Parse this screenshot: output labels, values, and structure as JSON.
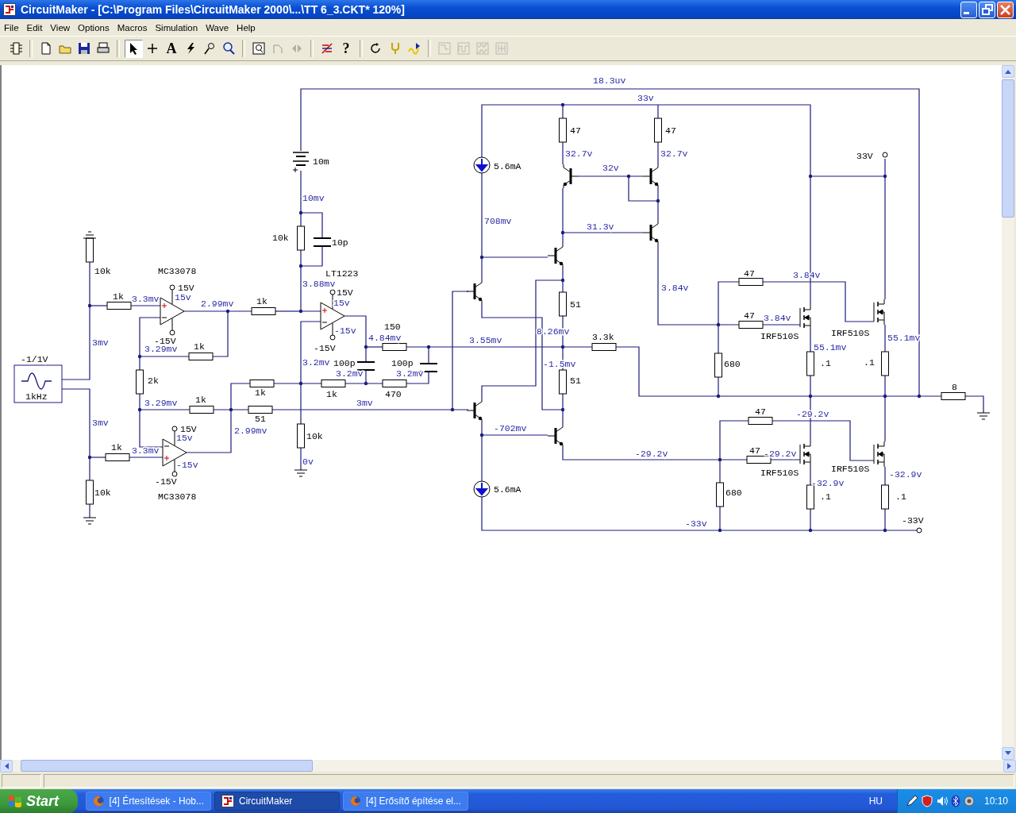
{
  "window": {
    "title": "CircuitMaker - [C:\\Program Files\\CircuitMaker 2000\\...\\TT 6_3.CKT* 120%]"
  },
  "menu": [
    "File",
    "Edit",
    "View",
    "Options",
    "Macros",
    "Simulation",
    "Wave",
    "Help"
  ],
  "toolbar": [
    {
      "selected": false,
      "disabled": false
    },
    {
      "selected": false,
      "disabled": false
    },
    {
      "selected": false,
      "disabled": false
    },
    {
      "selected": false,
      "disabled": false
    },
    {
      "selected": false,
      "disabled": false
    },
    {
      "selected": true,
      "disabled": false
    },
    {
      "selected": false,
      "disabled": false
    },
    {
      "selected": false,
      "disabled": false,
      "label": "A"
    },
    {
      "selected": false,
      "disabled": false
    },
    {
      "selected": false,
      "disabled": false
    },
    {
      "selected": false,
      "disabled": false
    },
    {
      "selected": false,
      "disabled": false
    },
    {
      "selected": false,
      "disabled": true
    },
    {
      "selected": false,
      "disabled": true
    },
    {
      "selected": false,
      "disabled": false
    },
    {
      "selected": false,
      "disabled": false,
      "label": "?"
    },
    {
      "selected": false,
      "disabled": false
    },
    {
      "selected": false,
      "disabled": false
    },
    {
      "selected": false,
      "disabled": false
    },
    {
      "selected": false,
      "disabled": true
    },
    {
      "selected": false,
      "disabled": true
    },
    {
      "selected": false,
      "disabled": true
    },
    {
      "selected": false,
      "disabled": true
    }
  ],
  "schematic": {
    "labels": [
      {
        "text": "18.3uv",
        "kind": "voltage"
      },
      {
        "text": "33v",
        "kind": "voltage"
      },
      {
        "text": "47",
        "kind": "part"
      },
      {
        "text": "47",
        "kind": "part"
      },
      {
        "text": "32.7v",
        "kind": "voltage"
      },
      {
        "text": "32.7v",
        "kind": "voltage"
      },
      {
        "text": "33V",
        "kind": "part"
      },
      {
        "text": "10m",
        "kind": "part"
      },
      {
        "text": "5.6mA",
        "kind": "part"
      },
      {
        "text": "32v",
        "kind": "voltage"
      },
      {
        "text": "10mv",
        "kind": "voltage"
      },
      {
        "text": "708mv",
        "kind": "voltage"
      },
      {
        "text": "31.3v",
        "kind": "voltage"
      },
      {
        "text": "10k",
        "kind": "part"
      },
      {
        "text": "10p",
        "kind": "part"
      },
      {
        "text": "10k",
        "kind": "part"
      },
      {
        "text": "MC33078",
        "kind": "part"
      },
      {
        "text": "LT1223",
        "kind": "part"
      },
      {
        "text": "47",
        "kind": "part"
      },
      {
        "text": "3.84v",
        "kind": "voltage"
      },
      {
        "text": "15V",
        "kind": "part"
      },
      {
        "text": "3.88mv",
        "kind": "voltage"
      },
      {
        "text": "3.84v",
        "kind": "voltage"
      },
      {
        "text": "15V",
        "kind": "part"
      },
      {
        "text": "1k",
        "kind": "part"
      },
      {
        "text": "3.3mv",
        "kind": "voltage"
      },
      {
        "text": "15v",
        "kind": "voltage"
      },
      {
        "text": "2.99mv",
        "kind": "voltage"
      },
      {
        "text": "1k",
        "kind": "part"
      },
      {
        "text": "15v",
        "kind": "voltage"
      },
      {
        "text": "51",
        "kind": "part"
      },
      {
        "text": "47",
        "kind": "part"
      },
      {
        "text": "3.84v",
        "kind": "voltage"
      },
      {
        "text": "-15v",
        "kind": "voltage"
      },
      {
        "text": "150",
        "kind": "part"
      },
      {
        "text": "8.26mv",
        "kind": "voltage"
      },
      {
        "text": "IRF510S",
        "kind": "part"
      },
      {
        "text": "3mv",
        "kind": "voltage"
      },
      {
        "text": "-15V",
        "kind": "part"
      },
      {
        "text": "4.84mv",
        "kind": "voltage"
      },
      {
        "text": "3.55mv",
        "kind": "voltage"
      },
      {
        "text": "3.3k",
        "kind": "part"
      },
      {
        "text": "IRF510S",
        "kind": "part"
      },
      {
        "text": "55.1mv",
        "kind": "voltage"
      },
      {
        "text": "3.29mv",
        "kind": "voltage"
      },
      {
        "text": "1k",
        "kind": "part"
      },
      {
        "text": "-15V",
        "kind": "part"
      },
      {
        "text": "55.1mv",
        "kind": "voltage"
      },
      {
        "text": "-1/1V",
        "kind": "part"
      },
      {
        "text": "3.2mv",
        "kind": "voltage"
      },
      {
        "text": "100p",
        "kind": "part"
      },
      {
        "text": "100p",
        "kind": "part"
      },
      {
        "text": "-1.5mv",
        "kind": "voltage"
      },
      {
        "text": "680",
        "kind": "part"
      },
      {
        "text": ".1",
        "kind": "part"
      },
      {
        "text": ".1",
        "kind": "part"
      },
      {
        "text": "3.2mv",
        "kind": "voltage"
      },
      {
        "text": "3.2mv",
        "kind": "voltage"
      },
      {
        "text": "2k",
        "kind": "part"
      },
      {
        "text": "51",
        "kind": "part"
      },
      {
        "text": "8",
        "kind": "part"
      },
      {
        "text": "1kHz",
        "kind": "part"
      },
      {
        "text": "1k",
        "kind": "part"
      },
      {
        "text": "1k",
        "kind": "part"
      },
      {
        "text": "470",
        "kind": "part"
      },
      {
        "text": "3.29mv",
        "kind": "voltage"
      },
      {
        "text": "1k",
        "kind": "part"
      },
      {
        "text": "3mv",
        "kind": "voltage"
      },
      {
        "text": "47",
        "kind": "part"
      },
      {
        "text": "-29.2v",
        "kind": "voltage"
      },
      {
        "text": "3mv",
        "kind": "voltage"
      },
      {
        "text": "51",
        "kind": "part"
      },
      {
        "text": "15V",
        "kind": "part"
      },
      {
        "text": "2.99mv",
        "kind": "voltage"
      },
      {
        "text": "-702mv",
        "kind": "voltage"
      },
      {
        "text": "15v",
        "kind": "voltage"
      },
      {
        "text": "10k",
        "kind": "part"
      },
      {
        "text": "1k",
        "kind": "part"
      },
      {
        "text": "3.3mv",
        "kind": "voltage"
      },
      {
        "text": "-29.2v",
        "kind": "voltage"
      },
      {
        "text": "47",
        "kind": "part"
      },
      {
        "text": "-29.2v",
        "kind": "voltage"
      },
      {
        "text": "-15v",
        "kind": "voltage"
      },
      {
        "text": "0v",
        "kind": "voltage"
      },
      {
        "text": "IRF510S",
        "kind": "part"
      },
      {
        "text": "IRF510S",
        "kind": "part"
      },
      {
        "text": "-32.9v",
        "kind": "voltage"
      },
      {
        "text": "-15V",
        "kind": "part"
      },
      {
        "text": "-32.9v",
        "kind": "voltage"
      },
      {
        "text": "10k",
        "kind": "part"
      },
      {
        "text": "MC33078",
        "kind": "part"
      },
      {
        "text": "5.6mA",
        "kind": "part"
      },
      {
        "text": "680",
        "kind": "part"
      },
      {
        "text": ".1",
        "kind": "part"
      },
      {
        "text": ".1",
        "kind": "part"
      },
      {
        "text": "-33v",
        "kind": "voltage"
      },
      {
        "text": "-33V",
        "kind": "part"
      }
    ]
  },
  "taskbar": {
    "start": "Start",
    "tasks": [
      {
        "label": "[4] Értesítések - Hob...",
        "kind": "browser",
        "selected": false
      },
      {
        "label": "CircuitMaker",
        "kind": "app",
        "selected": true
      },
      {
        "label": "[4] Erősítő építése el...",
        "kind": "browser",
        "selected": false
      }
    ],
    "language": "HU",
    "clock": "10:10"
  }
}
